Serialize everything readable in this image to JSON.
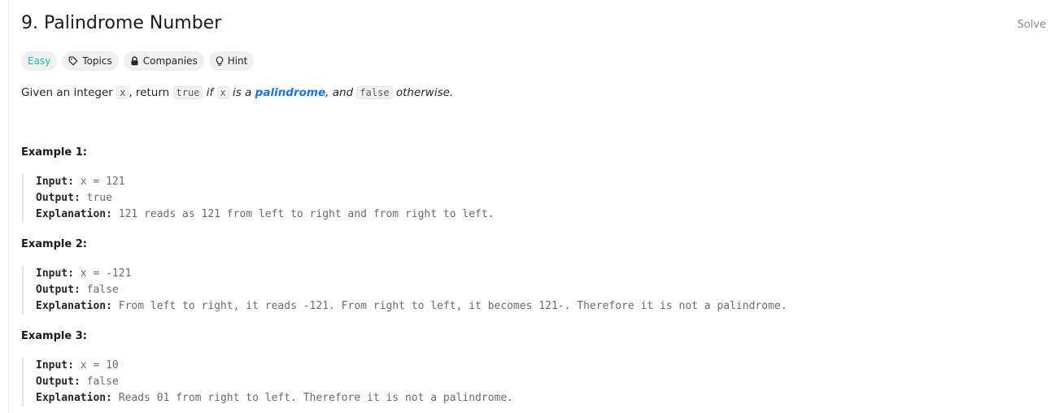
{
  "problem": {
    "title": "9. Palindrome Number",
    "solve_label": "Solve"
  },
  "tags": {
    "difficulty": "Easy",
    "topics": "Topics",
    "companies": "Companies",
    "hint": "Hint"
  },
  "description": {
    "p1": "Given an integer ",
    "code_x": "x",
    "p2": ", return ",
    "code_true": "true",
    "p3": " if ",
    "code_x2": "x",
    "p4": " is a ",
    "link": "palindrome",
    "p5": ", and ",
    "code_false": "false",
    "p6": " otherwise."
  },
  "examples": [
    {
      "heading": "Example 1:",
      "input_label": "Input:",
      "input": "x = 121",
      "output_label": "Output:",
      "output": "true",
      "explanation_label": "Explanation:",
      "explanation": "121 reads as 121 from left to right and from right to left."
    },
    {
      "heading": "Example 2:",
      "input_label": "Input:",
      "input": "x = -121",
      "output_label": "Output:",
      "output": "false",
      "explanation_label": "Explanation:",
      "explanation": "From left to right, it reads -121. From right to left, it becomes 121-. Therefore it is not a palindrome."
    },
    {
      "heading": "Example 3:",
      "input_label": "Input:",
      "input": "x = 10",
      "output_label": "Output:",
      "output": "false",
      "explanation_label": "Explanation:",
      "explanation": "Reads 01 from right to left. Therefore it is not a palindrome."
    }
  ],
  "colors": {
    "easy": "#1cb8b8",
    "link": "#1a73e8"
  }
}
